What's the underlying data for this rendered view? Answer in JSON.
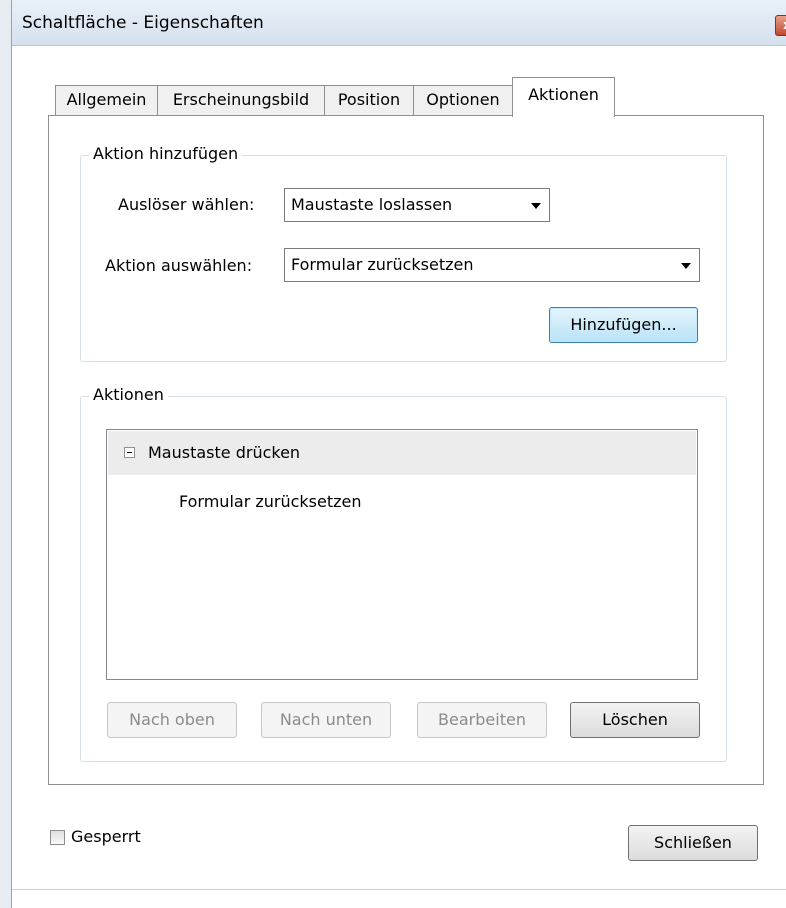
{
  "window": {
    "title": "Schaltfläche - Eigenschaften",
    "close_glyph": "x"
  },
  "tabs": [
    {
      "label": "Allgemein",
      "active": false
    },
    {
      "label": "Erscheinungsbild",
      "active": false
    },
    {
      "label": "Position",
      "active": false
    },
    {
      "label": "Optionen",
      "active": false
    },
    {
      "label": "Aktionen",
      "active": true
    }
  ],
  "add_action": {
    "legend": "Aktion hinzufügen",
    "trigger_label": "Auslöser wählen:",
    "trigger_value": "Maustaste loslassen",
    "action_label": "Aktion auswählen:",
    "action_value": "Formular zurücksetzen",
    "add_button": "Hinzufügen..."
  },
  "actions": {
    "legend": "Aktionen",
    "tree": [
      {
        "trigger": "Maustaste drücken",
        "expanded": true,
        "children": [
          "Formular zurücksetzen"
        ]
      }
    ],
    "buttons": {
      "up": "Nach oben",
      "down": "Nach unten",
      "edit": "Bearbeiten",
      "delete": "Löschen"
    }
  },
  "footer": {
    "locked_label": "Gesperrt",
    "locked_checked": false,
    "close_button": "Schließen"
  }
}
